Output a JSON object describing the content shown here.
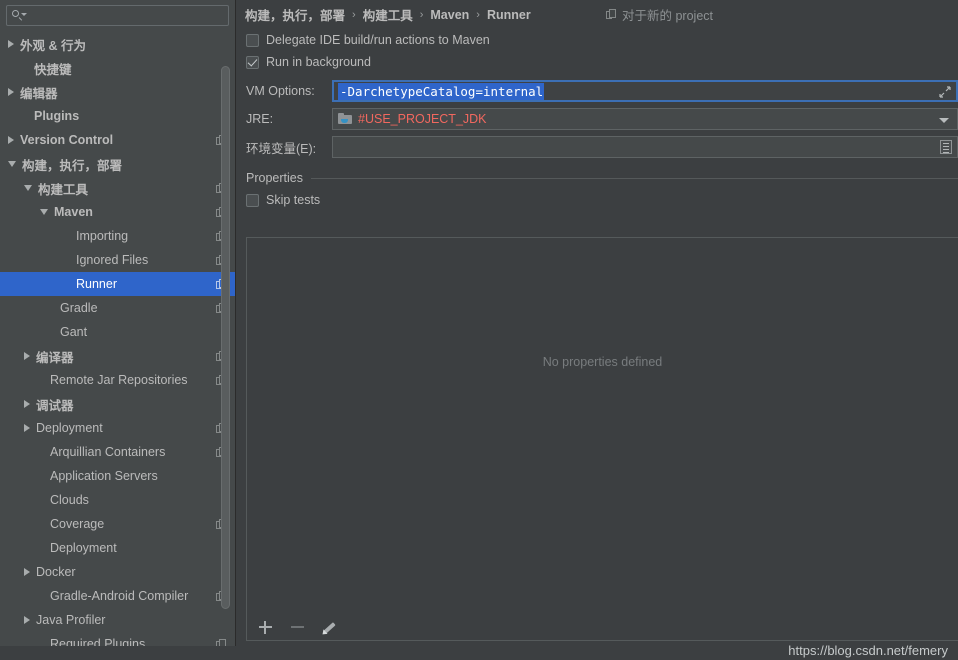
{
  "search": {
    "placeholder": "",
    "value": "",
    "icon": "search-icon"
  },
  "sidebar": {
    "items": [
      {
        "label": "外观 & 行为",
        "arrow": "collapsed",
        "indent": 8,
        "bold": true,
        "copy": false,
        "selected": false
      },
      {
        "label": "快捷键",
        "arrow": "none",
        "indent": 22,
        "bold": true,
        "copy": false,
        "selected": false
      },
      {
        "label": "编辑器",
        "arrow": "collapsed",
        "indent": 8,
        "bold": true,
        "copy": false,
        "selected": false
      },
      {
        "label": "Plugins",
        "arrow": "none",
        "indent": 22,
        "bold": true,
        "copy": false,
        "selected": false
      },
      {
        "label": "Version Control",
        "arrow": "collapsed",
        "indent": 8,
        "bold": true,
        "copy": true,
        "selected": false
      },
      {
        "label": "构建，执行，部署",
        "arrow": "expanded",
        "indent": 8,
        "bold": true,
        "copy": false,
        "selected": false
      },
      {
        "label": "构建工具",
        "arrow": "expanded",
        "indent": 24,
        "bold": true,
        "copy": true,
        "selected": false
      },
      {
        "label": "Maven",
        "arrow": "expanded",
        "indent": 40,
        "bold": true,
        "copy": true,
        "selected": false
      },
      {
        "label": "Importing",
        "arrow": "none",
        "indent": 64,
        "bold": false,
        "copy": true,
        "selected": false
      },
      {
        "label": "Ignored Files",
        "arrow": "none",
        "indent": 64,
        "bold": false,
        "copy": true,
        "selected": false
      },
      {
        "label": "Runner",
        "arrow": "none",
        "indent": 64,
        "bold": false,
        "copy": true,
        "selected": true
      },
      {
        "label": "Gradle",
        "arrow": "none",
        "indent": 48,
        "bold": false,
        "copy": true,
        "selected": false
      },
      {
        "label": "Gant",
        "arrow": "none",
        "indent": 48,
        "bold": false,
        "copy": false,
        "selected": false
      },
      {
        "label": "编译器",
        "arrow": "collapsed",
        "indent": 24,
        "bold": true,
        "copy": true,
        "selected": false
      },
      {
        "label": "Remote Jar Repositories",
        "arrow": "none",
        "indent": 38,
        "bold": false,
        "copy": true,
        "selected": false
      },
      {
        "label": "调试器",
        "arrow": "collapsed",
        "indent": 24,
        "bold": true,
        "copy": false,
        "selected": false
      },
      {
        "label": "Deployment",
        "arrow": "collapsed",
        "indent": 24,
        "bold": false,
        "copy": true,
        "selected": false
      },
      {
        "label": "Arquillian Containers",
        "arrow": "none",
        "indent": 38,
        "bold": false,
        "copy": true,
        "selected": false
      },
      {
        "label": "Application Servers",
        "arrow": "none",
        "indent": 38,
        "bold": false,
        "copy": false,
        "selected": false
      },
      {
        "label": "Clouds",
        "arrow": "none",
        "indent": 38,
        "bold": false,
        "copy": false,
        "selected": false
      },
      {
        "label": "Coverage",
        "arrow": "none",
        "indent": 38,
        "bold": false,
        "copy": true,
        "selected": false
      },
      {
        "label": "Deployment",
        "arrow": "none",
        "indent": 38,
        "bold": false,
        "copy": false,
        "selected": false
      },
      {
        "label": "Docker",
        "arrow": "collapsed",
        "indent": 24,
        "bold": false,
        "copy": false,
        "selected": false
      },
      {
        "label": "Gradle-Android Compiler",
        "arrow": "none",
        "indent": 38,
        "bold": false,
        "copy": true,
        "selected": false
      },
      {
        "label": "Java Profiler",
        "arrow": "collapsed",
        "indent": 24,
        "bold": false,
        "copy": false,
        "selected": false
      },
      {
        "label": "Required Plugins",
        "arrow": "none",
        "indent": 38,
        "bold": false,
        "copy": true,
        "selected": false
      }
    ]
  },
  "breadcrumb": {
    "crumbs": [
      "构建，执行，部署",
      "构建工具",
      "Maven",
      "Runner"
    ],
    "separator": "›",
    "scope_label": "对于新的 project",
    "scope_icon": "copy-icon"
  },
  "form": {
    "delegate": {
      "label": "Delegate IDE build/run actions to Maven",
      "checked": false
    },
    "run_in_background": {
      "label": "Run in background",
      "checked": true
    },
    "vm_options": {
      "label": "VM Options:",
      "value": "-DarchetypeCatalog=internal",
      "selected": true
    },
    "jre": {
      "label": "JRE:",
      "value": "#USE_PROJECT_JDK"
    },
    "env_vars": {
      "label": "环境变量(E):",
      "value": "",
      "placeholder": ""
    }
  },
  "properties": {
    "section_title": "Properties",
    "skip_tests": {
      "label": "Skip tests",
      "checked": false
    },
    "empty_text": "No properties defined",
    "toolbar": {
      "add_label": "+",
      "remove_label": "−",
      "edit_label": "edit"
    }
  },
  "watermark": "https://blog.csdn.net/femery",
  "colors": {
    "accent_selection": "#2f65ca",
    "panel_bg": "#3c3f41",
    "sidebar_bg": "#45494a",
    "jre_value": "#f2685f",
    "text": "#bbbbbb"
  }
}
